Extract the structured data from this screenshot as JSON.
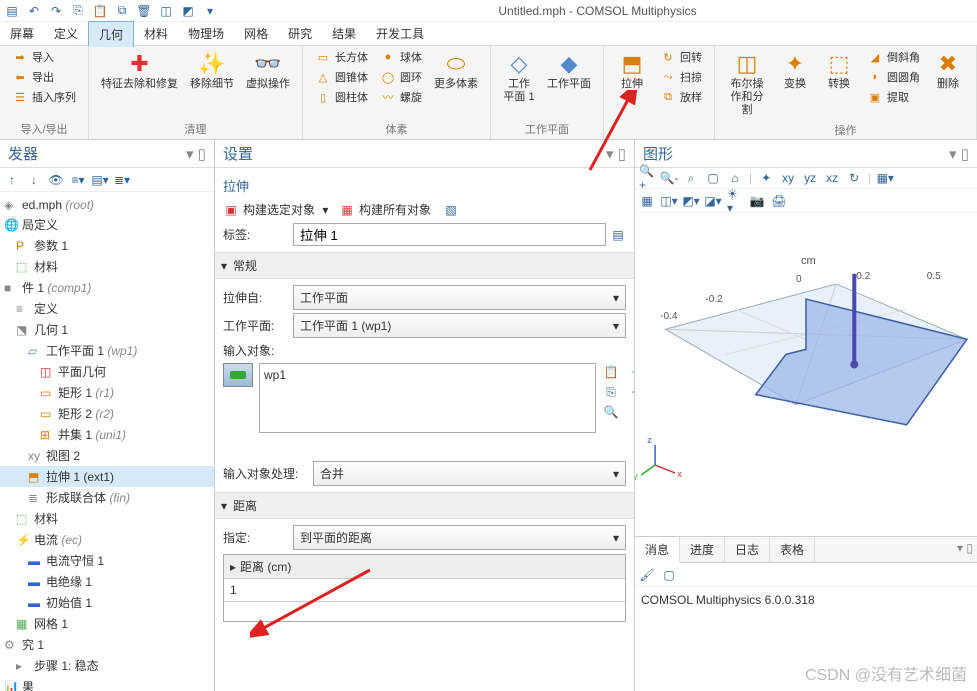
{
  "title": "Untitled.mph - COMSOL Multiphysics",
  "menubar": [
    "屏幕",
    "定义",
    "几何",
    "材料",
    "物理场",
    "网格",
    "研究",
    "结果",
    "开发工具"
  ],
  "menubar_active": 2,
  "ribbon": {
    "group1": {
      "label": "导入/导出",
      "items": [
        "导入",
        "导出",
        "插入序列"
      ]
    },
    "group2": {
      "label": "清理",
      "items": [
        "特征去除和修复",
        "移除细节",
        "虚拟操作"
      ]
    },
    "group3": {
      "label": "体素",
      "col1": [
        "长方体",
        "圆锥体",
        "圆柱体"
      ],
      "col2": [
        "球体",
        "圆环",
        "螺旋"
      ],
      "more": "更多体素"
    },
    "group4": {
      "label": "工作平面",
      "items": [
        "工作\n平面 1",
        "工作平面"
      ]
    },
    "group5": {
      "label": "",
      "main": "拉伸",
      "side": [
        "回转",
        "扫掠",
        "放样"
      ]
    },
    "group6": {
      "label": "操作",
      "items": [
        "布尔操作和分割",
        "变换",
        "转换"
      ],
      "side": [
        "倒斜角",
        "圆圆角",
        "提取"
      ],
      "del": "删除"
    }
  },
  "left_panel": {
    "title": "发器",
    "nodes": [
      {
        "label": "ed.mph (root)",
        "indent": 0,
        "icon": "root"
      },
      {
        "label": "局定义",
        "indent": 0,
        "icon": "global"
      },
      {
        "label": "参数 1",
        "indent": 1,
        "icon": "param"
      },
      {
        "label": "材料",
        "indent": 1,
        "icon": "material"
      },
      {
        "label": "件 1 (comp1)",
        "indent": 0,
        "icon": "comp"
      },
      {
        "label": "定义",
        "indent": 1,
        "icon": "def"
      },
      {
        "label": "几何 1",
        "indent": 1,
        "icon": "geom"
      },
      {
        "label": "工作平面 1 (wp1)",
        "indent": 2,
        "icon": "wp"
      },
      {
        "label": "平面几何",
        "indent": 3,
        "icon": "pg"
      },
      {
        "label": "矩形 1 (r1)",
        "indent": 3,
        "icon": "rect"
      },
      {
        "label": "矩形 2 (r2)",
        "indent": 3,
        "icon": "rect"
      },
      {
        "label": "并集 1 (uni1)",
        "indent": 3,
        "icon": "union"
      },
      {
        "label": "视图 2",
        "indent": 2,
        "icon": "view"
      },
      {
        "label": "拉伸 1 (ext1)",
        "indent": 2,
        "icon": "ext",
        "selected": true
      },
      {
        "label": "形成联合体 (fin)",
        "indent": 2,
        "icon": "fin"
      },
      {
        "label": "材料",
        "indent": 1,
        "icon": "material"
      },
      {
        "label": "电流 (ec)",
        "indent": 1,
        "icon": "ec"
      },
      {
        "label": "电流守恒 1",
        "indent": 2,
        "icon": "phys"
      },
      {
        "label": "电绝缘 1",
        "indent": 2,
        "icon": "phys"
      },
      {
        "label": "初始值 1",
        "indent": 2,
        "icon": "phys"
      },
      {
        "label": "网格 1",
        "indent": 1,
        "icon": "mesh"
      },
      {
        "label": "究 1",
        "indent": 0,
        "icon": "study"
      },
      {
        "label": "步骤 1: 稳态",
        "indent": 1,
        "icon": "step"
      },
      {
        "label": "果",
        "indent": 0,
        "icon": "result"
      }
    ]
  },
  "settings": {
    "title": "设置",
    "subtitle": "拉伸",
    "build_sel": "构建选定对象",
    "build_all": "构建所有对象",
    "label_label": "标签:",
    "label_value": "拉伸 1",
    "section_general": "常规",
    "from_label": "拉伸自:",
    "from_value": "工作平面",
    "wp_label": "工作平面:",
    "wp_value": "工作平面 1 (wp1)",
    "input_label": "输入对象:",
    "input_item": "wp1",
    "handle_label": "输入对象处理:",
    "handle_value": "合并",
    "section_dist": "距离",
    "spec_label": "指定:",
    "spec_value": "到平面的距离",
    "dist_col": "距离 (cm)",
    "dist_value": "1"
  },
  "graphics": {
    "title": "图形",
    "axis_unit": "cm",
    "ticks": [
      "-0.4",
      "-0.2",
      "0",
      "0.2",
      "0.5"
    ],
    "axes": {
      "x": "x",
      "y": "y",
      "z": "z"
    }
  },
  "messages": {
    "tabs": [
      "消息",
      "进度",
      "日志",
      "表格"
    ],
    "active": 0,
    "text": "COMSOL Multiphysics 6.0.0.318"
  },
  "watermark": "CSDN @没有艺术细菌"
}
